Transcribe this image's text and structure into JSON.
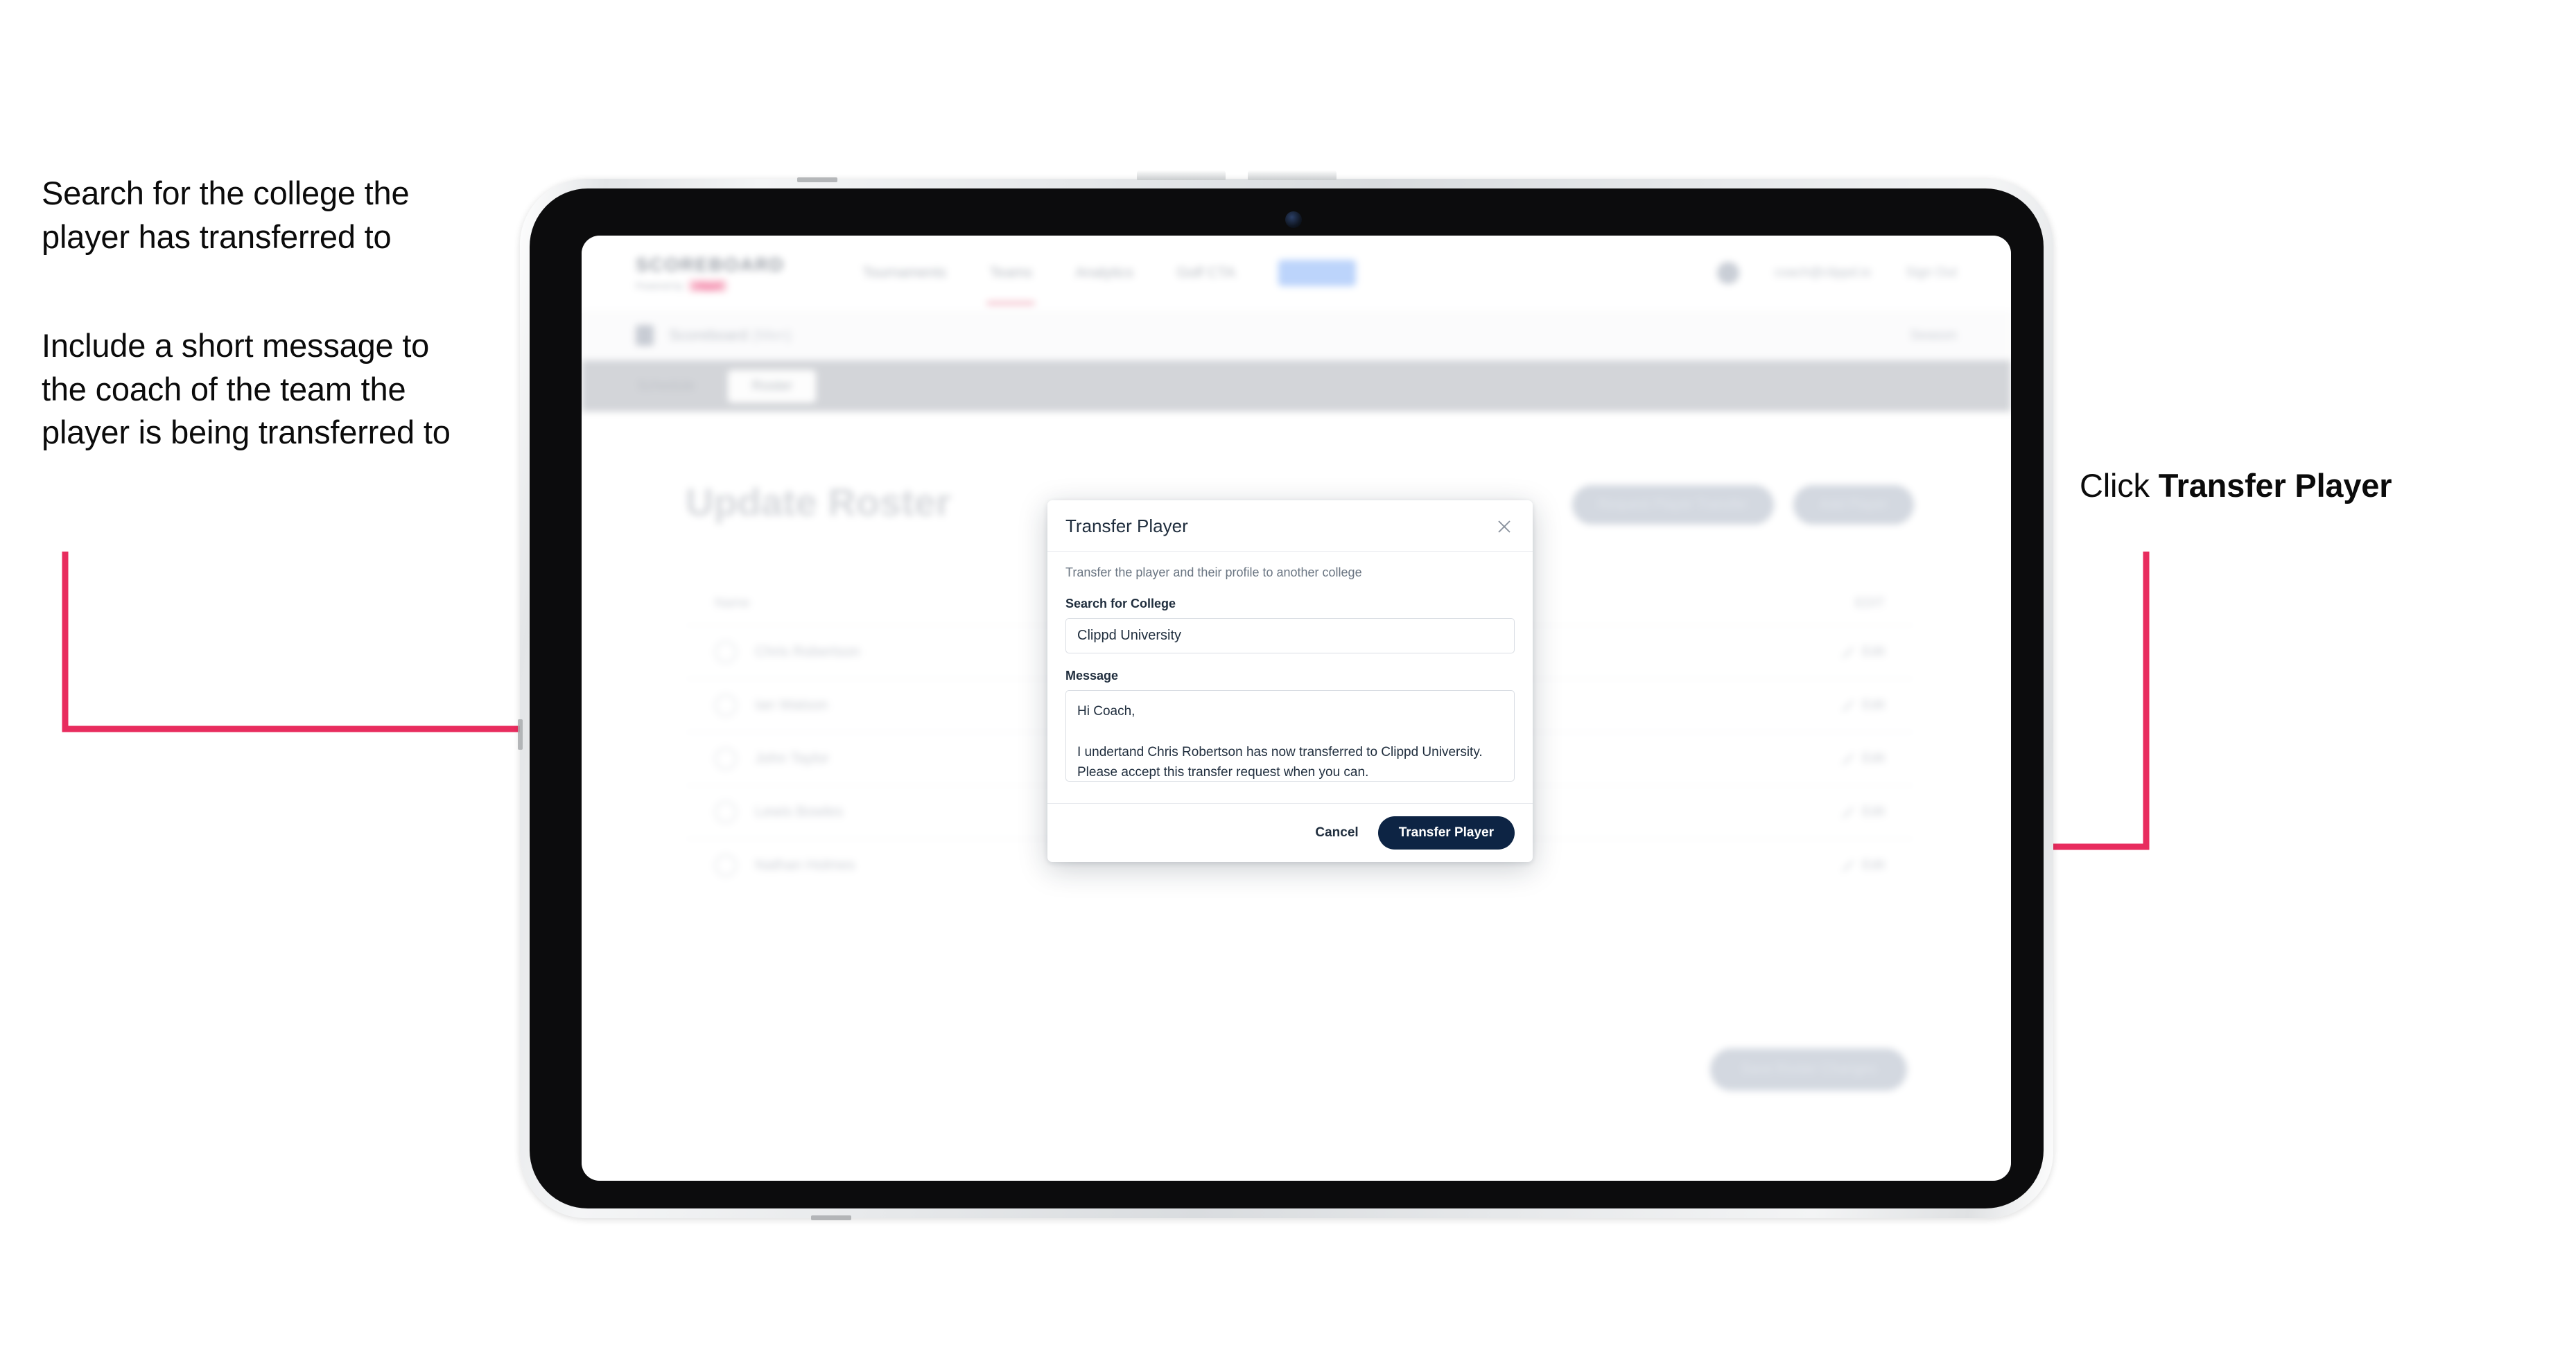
{
  "annotations": {
    "left_note_1": "Search for the college the player has transferred to",
    "left_note_2": "Include a short message to the coach of the team the player is being transferred to",
    "right_note_prefix": "Click ",
    "right_note_bold": "Transfer Player",
    "arrow_color": "#E82C5E"
  },
  "app": {
    "brand": {
      "name": "SCOREBOARD",
      "sub_text": "Powered by",
      "sub_pill": "clippd"
    },
    "nav": {
      "links": [
        {
          "label": "Tournaments",
          "active": false
        },
        {
          "label": "Teams",
          "active": true
        },
        {
          "label": "Analytics",
          "active": false
        },
        {
          "label": "Golf CTA",
          "active": false
        }
      ],
      "pill_label": "Admin",
      "user_email": "coach@clippd.io",
      "sign_out_label": "Sign Out"
    },
    "breadcrumb": {
      "title": "Scoreboard",
      "muted": "(Men)",
      "right_label": "Season"
    },
    "tabs": [
      {
        "label": "Schedule",
        "selected": false
      },
      {
        "label": "Roster",
        "selected": true
      }
    ],
    "page_title": "Update Roster",
    "page_actions": [
      "Request Player Transfer",
      "Add Player"
    ],
    "roster": {
      "col_name": "Name",
      "col_right": "EDIT",
      "rows": [
        {
          "name": "Chris Robertson",
          "edit": "Edit"
        },
        {
          "name": "Ian Watson",
          "edit": "Edit"
        },
        {
          "name": "John Taylor",
          "edit": "Edit"
        },
        {
          "name": "Lewis Bowles",
          "edit": "Edit"
        },
        {
          "name": "Nathan Holmes",
          "edit": "Edit"
        }
      ]
    },
    "save_button": "Save Roster Changes"
  },
  "modal": {
    "title": "Transfer Player",
    "close_icon": "close-icon",
    "description": "Transfer the player and their profile to another college",
    "college_label": "Search for College",
    "college_value": "Clippd University",
    "college_placeholder": "Search for College",
    "message_label": "Message",
    "message_value": "Hi Coach,\n\nI undertand Chris Robertson has now transferred to Clippd University. Please accept this transfer request when you can.",
    "message_placeholder": "Message",
    "cancel_label": "Cancel",
    "submit_label": "Transfer Player",
    "submit_color": "#0D2444"
  }
}
